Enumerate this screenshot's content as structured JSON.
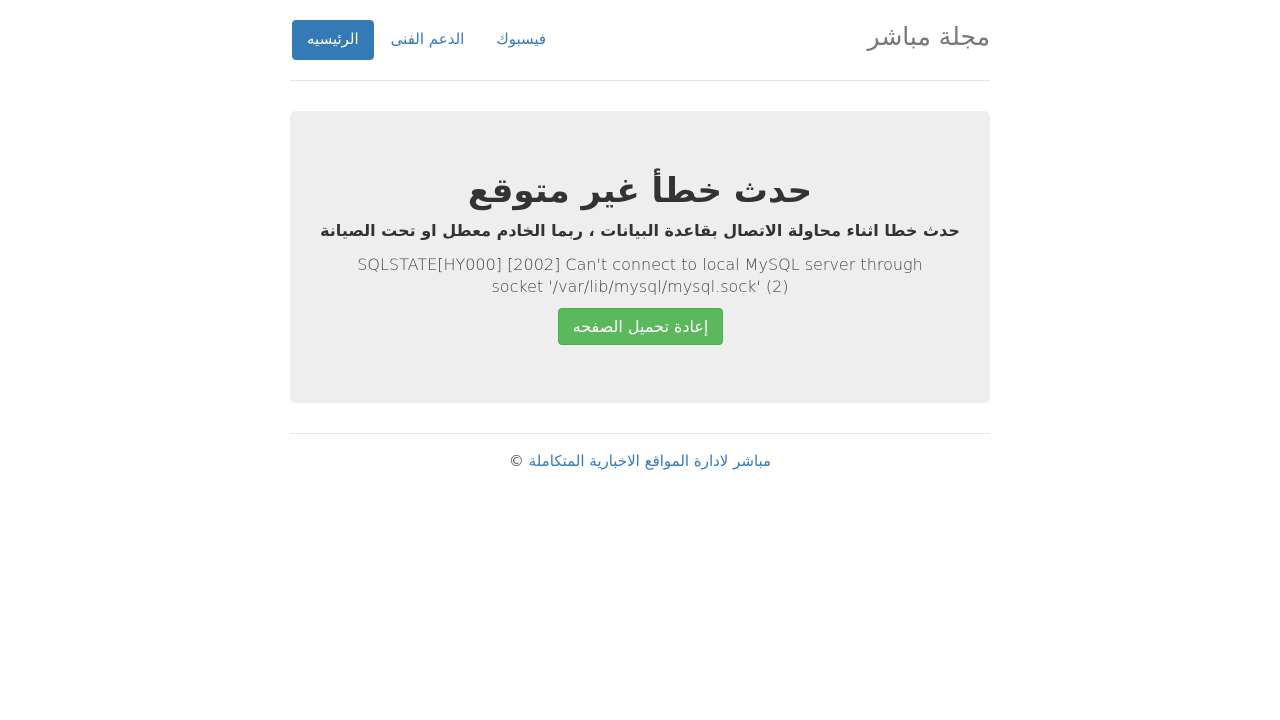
{
  "header": {
    "brand": "مجلة مباشر",
    "nav": [
      {
        "label": "الرئيسيه",
        "active": true
      },
      {
        "label": "الدعم الفنى",
        "active": false
      },
      {
        "label": "فيسبوك",
        "active": false
      }
    ]
  },
  "error": {
    "title": "حدث خطأ غير متوقع",
    "subtitle": "حدث خطا اثناء محاولة الاتصال بقاعدة البيانات ، ربما الخادم معطل او تحت الصيانة",
    "detail": "SQLSTATE[HY000] [2002] Can't connect to local MySQL server through socket '/var/lib/mysql/mysql.sock' (2)",
    "reload_label": "إعادة تحميل الصفحه"
  },
  "footer": {
    "copyright": "©",
    "link_text": "مباشر لادارة المواقع الاخبارية المتكاملة"
  },
  "colors": {
    "primary": "#337ab7",
    "success": "#5cb85c",
    "jumbotron_bg": "#eeeeee"
  }
}
